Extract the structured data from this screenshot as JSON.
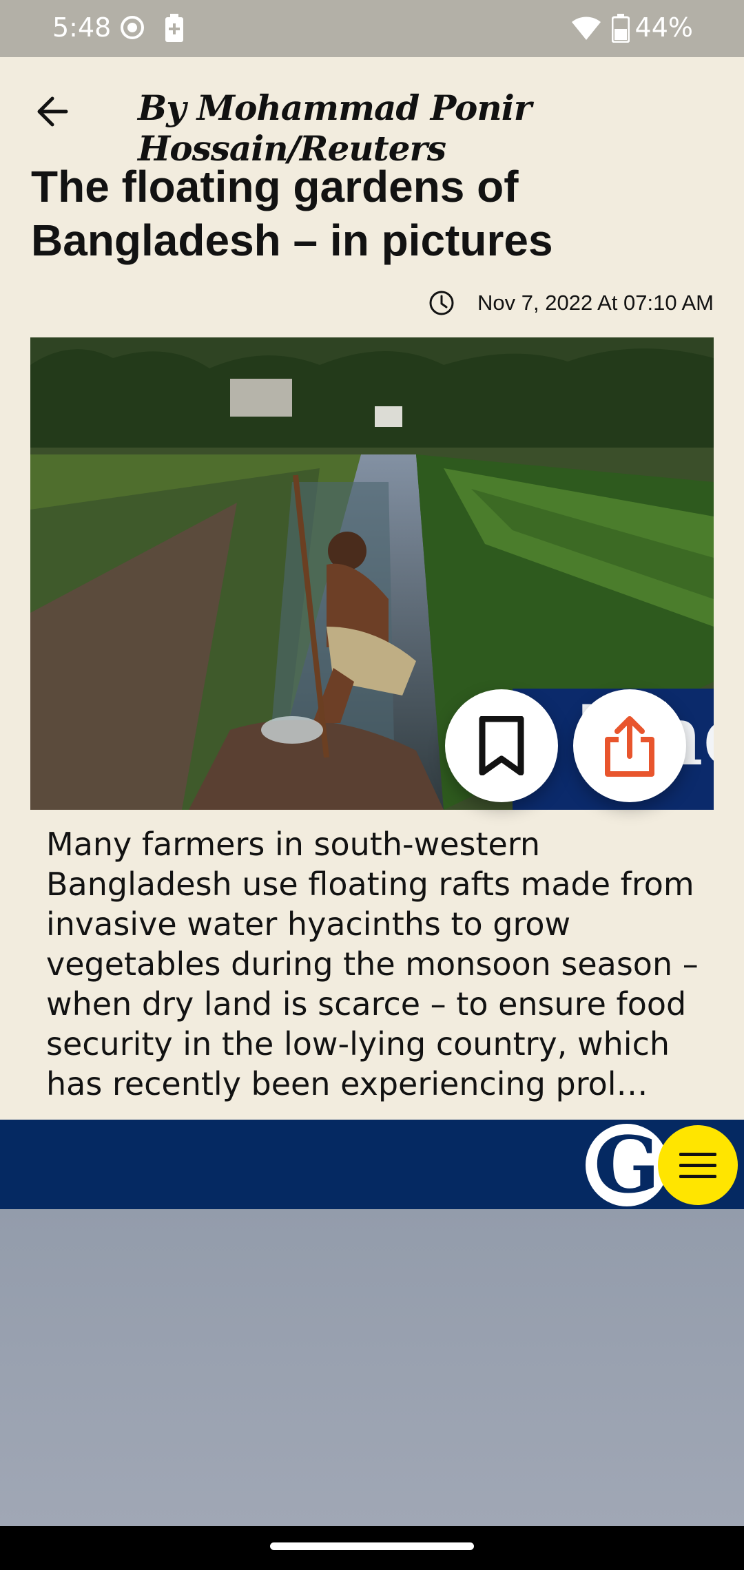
{
  "status_bar": {
    "time": "5:48",
    "battery_percent": "44%",
    "icons": [
      "record-icon",
      "battery-saver-icon",
      "wifi-icon",
      "battery-icon"
    ]
  },
  "header": {
    "byline": "By Mohammad Ponir Hossain/Reuters",
    "back_icon": "arrow-left-icon"
  },
  "article": {
    "title": "The floating gardens of Bangladesh – in pictures",
    "date": "Nov 7, 2022 At 07:10 AM",
    "date_icon": "clock-icon",
    "summary": "Many farmers in south-western Bangladesh use floating rafts made from invasive water hyacinths to grow vegetables during the monsoon season – when dry land is scarce – to ensure food security in the low-lying country, which has recently been experiencing prol…"
  },
  "actions": {
    "bookmark_icon": "bookmark-icon",
    "share_icon": "share-icon",
    "share_color": "#e8552d"
  },
  "footer": {
    "logo_letter": "G",
    "logo_overlay_text": "The Guardian",
    "brand_color": "#052962",
    "menu_color": "#ffe500",
    "menu_icon": "hamburger-menu-icon"
  }
}
